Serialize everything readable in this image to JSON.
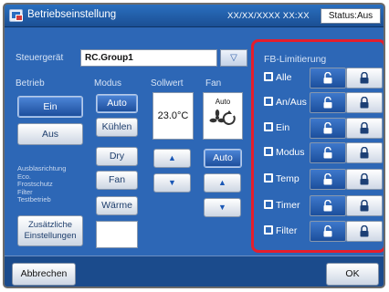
{
  "titlebar": {
    "title": "Betriebseinstellung",
    "datetime": "XX/XX/XXXX  XX:XX",
    "status": "Status:Aus"
  },
  "controller": {
    "label": "Steuergerät",
    "value": "RC.Group1",
    "dropdown_icon": "▽"
  },
  "betrieb": {
    "header": "Betrieb",
    "on_label": "Ein",
    "off_label": "Aus",
    "selected": "Ein"
  },
  "modus": {
    "header": "Modus",
    "options": [
      "Auto",
      "Kühlen",
      "Dry",
      "Fan",
      "Wärme"
    ],
    "selected": "Auto"
  },
  "sollwert": {
    "header": "Sollwert",
    "value": "23.0°C",
    "up_icon": "▲",
    "down_icon": "▼"
  },
  "fan": {
    "header": "Fan",
    "mode_text": "Auto",
    "auto_button": "Auto",
    "up_icon": "▲",
    "down_icon": "▼"
  },
  "side_notes": {
    "lines": [
      "Ausblasrichtung",
      "Eco.",
      "Frostschutz",
      "Filter",
      "Testbetrieb"
    ]
  },
  "extra_button": {
    "line1": "Zusätzliche",
    "line2": "Einstellungen"
  },
  "fb": {
    "title": "FB-Limitierung",
    "rows": [
      {
        "label": "Alle",
        "icon": "all-icon",
        "state": "unlocked"
      },
      {
        "label": "An/Aus",
        "icon": "power-icon",
        "state": "unlocked"
      },
      {
        "label": "Ein",
        "icon": "on-icon",
        "state": "unlocked"
      },
      {
        "label": "Modus",
        "icon": "mode-icon",
        "state": "unlocked"
      },
      {
        "label": "Temp",
        "icon": "temp-icon",
        "state": "unlocked"
      },
      {
        "label": "Timer",
        "icon": "timer-icon",
        "state": "unlocked"
      },
      {
        "label": "Filter",
        "icon": "filter-icon",
        "state": "unlocked"
      }
    ]
  },
  "footer": {
    "cancel": "Abbrechen",
    "ok": "OK"
  },
  "colors": {
    "highlight_border": "#e51e2c",
    "panel_blue": "#2d67b6",
    "active_button": "#1b4c9a"
  }
}
